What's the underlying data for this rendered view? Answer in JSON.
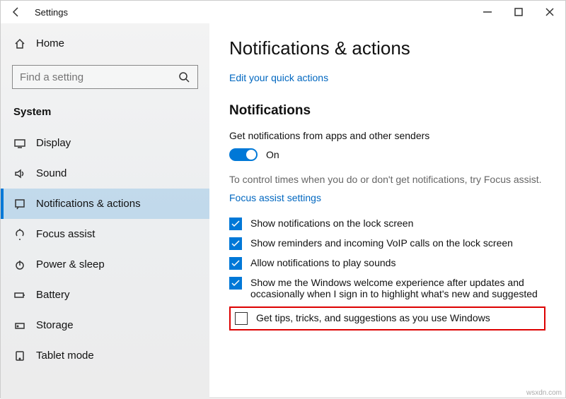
{
  "window": {
    "title": "Settings"
  },
  "sidebar": {
    "home": "Home",
    "search_placeholder": "Find a setting",
    "category": "System",
    "items": [
      {
        "label": "Display"
      },
      {
        "label": "Sound"
      },
      {
        "label": "Notifications & actions"
      },
      {
        "label": "Focus assist"
      },
      {
        "label": "Power & sleep"
      },
      {
        "label": "Battery"
      },
      {
        "label": "Storage"
      },
      {
        "label": "Tablet mode"
      }
    ]
  },
  "main": {
    "title": "Notifications & actions",
    "quick_actions_link": "Edit your quick actions",
    "section_title": "Notifications",
    "get_notifs": "Get notifications from apps and other senders",
    "toggle_state": "On",
    "focus_text": "To control times when you do or don't get notifications, try Focus assist.",
    "focus_link": "Focus assist settings",
    "checks": [
      {
        "checked": true,
        "label": "Show notifications on the lock screen"
      },
      {
        "checked": true,
        "label": "Show reminders and incoming VoIP calls on the lock screen"
      },
      {
        "checked": true,
        "label": "Allow notifications to play sounds"
      },
      {
        "checked": true,
        "label": "Show me the Windows welcome experience after updates and occasionally when I sign in to highlight what's new and suggested"
      },
      {
        "checked": false,
        "label": "Get tips, tricks, and suggestions as you use Windows"
      }
    ]
  },
  "watermark": "wsxdn.com"
}
